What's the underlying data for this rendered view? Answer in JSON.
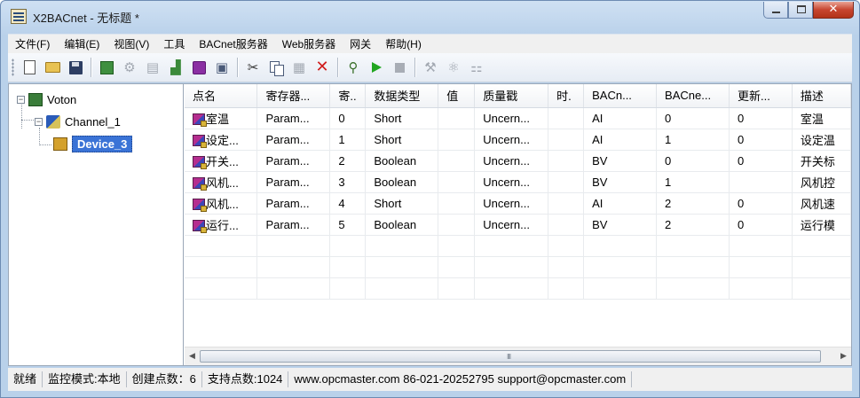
{
  "window": {
    "title": "X2BACnet - 无标题 *"
  },
  "menu": [
    "文件(F)",
    "编辑(E)",
    "视图(V)",
    "工具",
    "BACnet服务器",
    "Web服务器",
    "网关",
    "帮助(H)"
  ],
  "toolbar": {
    "icons": [
      "new-file-icon",
      "open-folder-icon",
      "save-icon",
      "add-channel-icon",
      "add-device-icon",
      "add-point-icon",
      "import-icon",
      "add-purple-icon",
      "properties-icon",
      "cut-icon",
      "copy-icon",
      "paste-icon",
      "delete-icon",
      "search-icon",
      "run-icon",
      "stop-icon",
      "tool-icon",
      "mapping-icon",
      "batch-icon"
    ]
  },
  "tree": {
    "root": "Voton",
    "channel": "Channel_1",
    "device": "Device_3"
  },
  "table": {
    "columns": [
      "点名",
      "寄存器...",
      "寄..",
      "数据类型",
      "值",
      "质量戳",
      "时.",
      "BACn...",
      "BACne...",
      "更新...",
      "描述"
    ],
    "rows": [
      [
        "室温",
        "Param...",
        "0",
        "Short",
        "",
        "Uncern...",
        "",
        "AI",
        "0",
        "0",
        "室温"
      ],
      [
        "设定...",
        "Param...",
        "1",
        "Short",
        "",
        "Uncern...",
        "",
        "AI",
        "1",
        "0",
        "设定温"
      ],
      [
        "开关...",
        "Param...",
        "2",
        "Boolean",
        "",
        "Uncern...",
        "",
        "BV",
        "0",
        "0",
        "开关标"
      ],
      [
        "风机...",
        "Param...",
        "3",
        "Boolean",
        "",
        "Uncern...",
        "",
        "BV",
        "1",
        "",
        "风机控"
      ],
      [
        "风机...",
        "Param...",
        "4",
        "Short",
        "",
        "Uncern...",
        "",
        "AI",
        "2",
        "0",
        "风机速"
      ],
      [
        "运行...",
        "Param...",
        "5",
        "Boolean",
        "",
        "Uncern...",
        "",
        "BV",
        "2",
        "0",
        "运行模"
      ]
    ],
    "empty_rows": 3
  },
  "scrollbar": {
    "grip": "III"
  },
  "status": {
    "ready": "就绪",
    "mode": "监控模式:本地",
    "created": "创建点数：6",
    "supported": "支持点数:1024",
    "contact": "www.opcmaster.com 86-021-20252795 support@opcmaster.com"
  }
}
